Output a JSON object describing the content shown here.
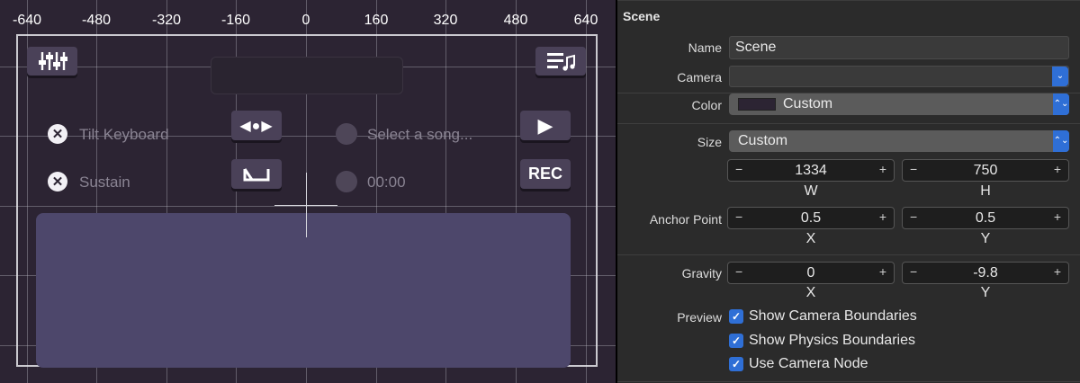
{
  "ruler": {
    "labels": [
      "-640",
      "-480",
      "-320",
      "-160",
      "0",
      "160",
      "320",
      "480",
      "640"
    ]
  },
  "scene_ui": {
    "mixer_icon": "sliders-icon",
    "playlist_icon": "playlist-music-icon",
    "tilt_label": "Tilt Keyboard",
    "sustain_label": "Sustain",
    "select_song_label": "Select a song...",
    "time_label": "00:00",
    "check_mark": "✕",
    "arrows_glyph": "◀●▶",
    "play_glyph": "▶",
    "rec_label": "REC",
    "loop_icon": "loop-bracket-icon"
  },
  "inspector": {
    "section_title": "Scene",
    "name": {
      "label": "Name",
      "value": "Scene"
    },
    "camera": {
      "label": "Camera",
      "value": ""
    },
    "color": {
      "label": "Color",
      "value": "Custom",
      "swatch": "#2c2433"
    },
    "size": {
      "label": "Size",
      "preset": "Custom",
      "width": "1334",
      "height": "750",
      "w_label": "W",
      "h_label": "H"
    },
    "anchor_point": {
      "label": "Anchor Point",
      "x": "0.5",
      "y": "0.5",
      "x_label": "X",
      "y_label": "Y"
    },
    "gravity": {
      "label": "Gravity",
      "x": "0",
      "y": "-9.8",
      "x_label": "X",
      "y_label": "Y"
    },
    "preview": {
      "label": "Preview",
      "options": [
        {
          "label": "Show Camera Boundaries",
          "checked": true
        },
        {
          "label": "Show Physics Boundaries",
          "checked": true
        },
        {
          "label": "Use Camera Node",
          "checked": true
        }
      ]
    },
    "stepper_minus": "−",
    "stepper_plus": "+",
    "popup_chevron": "⌄",
    "popup_updown": "⌃⌄"
  },
  "colors": {
    "accent": "#2f6fd6",
    "scene_bg": "#2c2433",
    "keyboard": "#4d476b"
  }
}
